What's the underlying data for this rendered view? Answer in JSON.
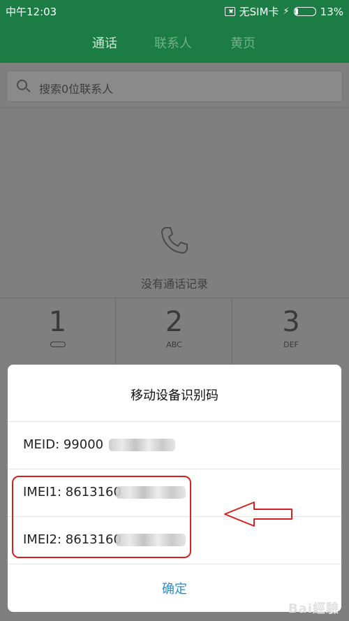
{
  "status_bar": {
    "time": "中午12:03",
    "sim_status": "无SIM卡",
    "battery_percent": "13%",
    "battery_level": 0.13
  },
  "header": {
    "tabs": [
      {
        "label": "通话",
        "active": true
      },
      {
        "label": "联系人",
        "active": false
      },
      {
        "label": "黄页",
        "active": false
      }
    ]
  },
  "search": {
    "placeholder": "搜索0位联系人"
  },
  "empty_state": {
    "icon": "phone-icon",
    "text": "没有通话记录"
  },
  "keypad": {
    "keys": [
      {
        "number": "1",
        "sub": "",
        "icon": "voicemail-icon"
      },
      {
        "number": "2",
        "sub": "ABC"
      },
      {
        "number": "3",
        "sub": "DEF"
      }
    ]
  },
  "dialog": {
    "title": "移动设备识别码",
    "rows": [
      {
        "label": "MEID: 99000"
      },
      {
        "label": "IMEI1: 8613160"
      },
      {
        "label": "IMEI2: 8613160"
      }
    ],
    "confirm_label": "确定"
  },
  "annotation": {
    "highlight_color": "#d61f1f",
    "arrow_color": "#d61f1f"
  },
  "watermark": {
    "text": "Bai經驗"
  },
  "colors": {
    "header_green": "#1b7d43",
    "confirm_blue": "#2b8ccc"
  }
}
